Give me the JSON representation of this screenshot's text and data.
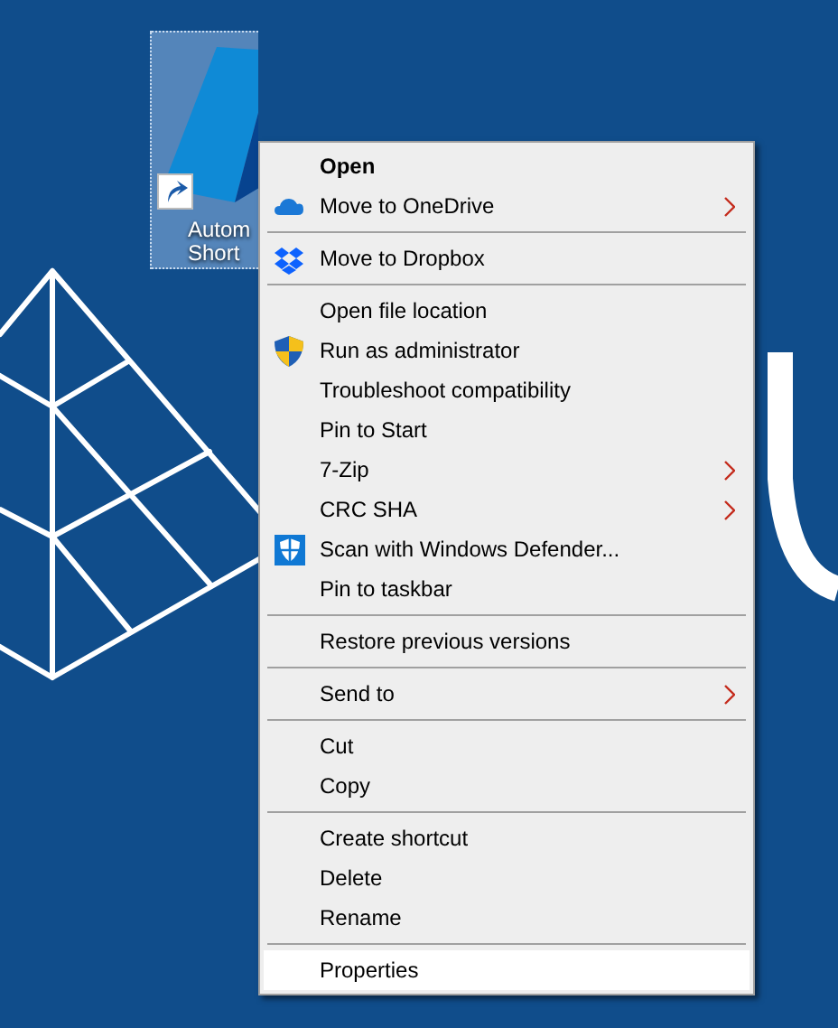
{
  "desktop_icon": {
    "label_lines": [
      "Autom",
      "Short"
    ],
    "selected": true,
    "shortcut": true
  },
  "context_menu": {
    "items": [
      {
        "kind": "item",
        "label": "Open",
        "bold": true,
        "submenu": false,
        "selected": false
      },
      {
        "kind": "item",
        "label": "Move to OneDrive",
        "bold": false,
        "submenu": true,
        "selected": false
      },
      {
        "kind": "separator"
      },
      {
        "kind": "item",
        "label": "Move to Dropbox",
        "bold": false,
        "submenu": false,
        "selected": false
      },
      {
        "kind": "separator"
      },
      {
        "kind": "item",
        "label": "Open file location",
        "bold": false,
        "submenu": false,
        "selected": false
      },
      {
        "kind": "item",
        "label": "Run as administrator",
        "bold": false,
        "submenu": false,
        "selected": false
      },
      {
        "kind": "item",
        "label": "Troubleshoot compatibility",
        "bold": false,
        "submenu": false,
        "selected": false
      },
      {
        "kind": "item",
        "label": "Pin to Start",
        "bold": false,
        "submenu": false,
        "selected": false
      },
      {
        "kind": "item",
        "label": "7-Zip",
        "bold": false,
        "submenu": true,
        "selected": false
      },
      {
        "kind": "item",
        "label": "CRC SHA",
        "bold": false,
        "submenu": true,
        "selected": false
      },
      {
        "kind": "item",
        "label": "Scan with Windows Defender...",
        "bold": false,
        "submenu": false,
        "selected": false
      },
      {
        "kind": "item",
        "label": "Pin to taskbar",
        "bold": false,
        "submenu": false,
        "selected": false
      },
      {
        "kind": "separator"
      },
      {
        "kind": "item",
        "label": "Restore previous versions",
        "bold": false,
        "submenu": false,
        "selected": false
      },
      {
        "kind": "separator"
      },
      {
        "kind": "item",
        "label": "Send to",
        "bold": false,
        "submenu": true,
        "selected": false
      },
      {
        "kind": "separator"
      },
      {
        "kind": "item",
        "label": "Cut",
        "bold": false,
        "submenu": false,
        "selected": false
      },
      {
        "kind": "item",
        "label": "Copy",
        "bold": false,
        "submenu": false,
        "selected": false
      },
      {
        "kind": "separator"
      },
      {
        "kind": "item",
        "label": "Create shortcut",
        "bold": false,
        "submenu": false,
        "selected": false
      },
      {
        "kind": "item",
        "label": "Delete",
        "bold": false,
        "submenu": false,
        "selected": false
      },
      {
        "kind": "item",
        "label": "Rename",
        "bold": false,
        "submenu": false,
        "selected": false
      },
      {
        "kind": "separator"
      },
      {
        "kind": "item",
        "label": "Properties",
        "bold": false,
        "submenu": false,
        "selected": true
      }
    ]
  }
}
